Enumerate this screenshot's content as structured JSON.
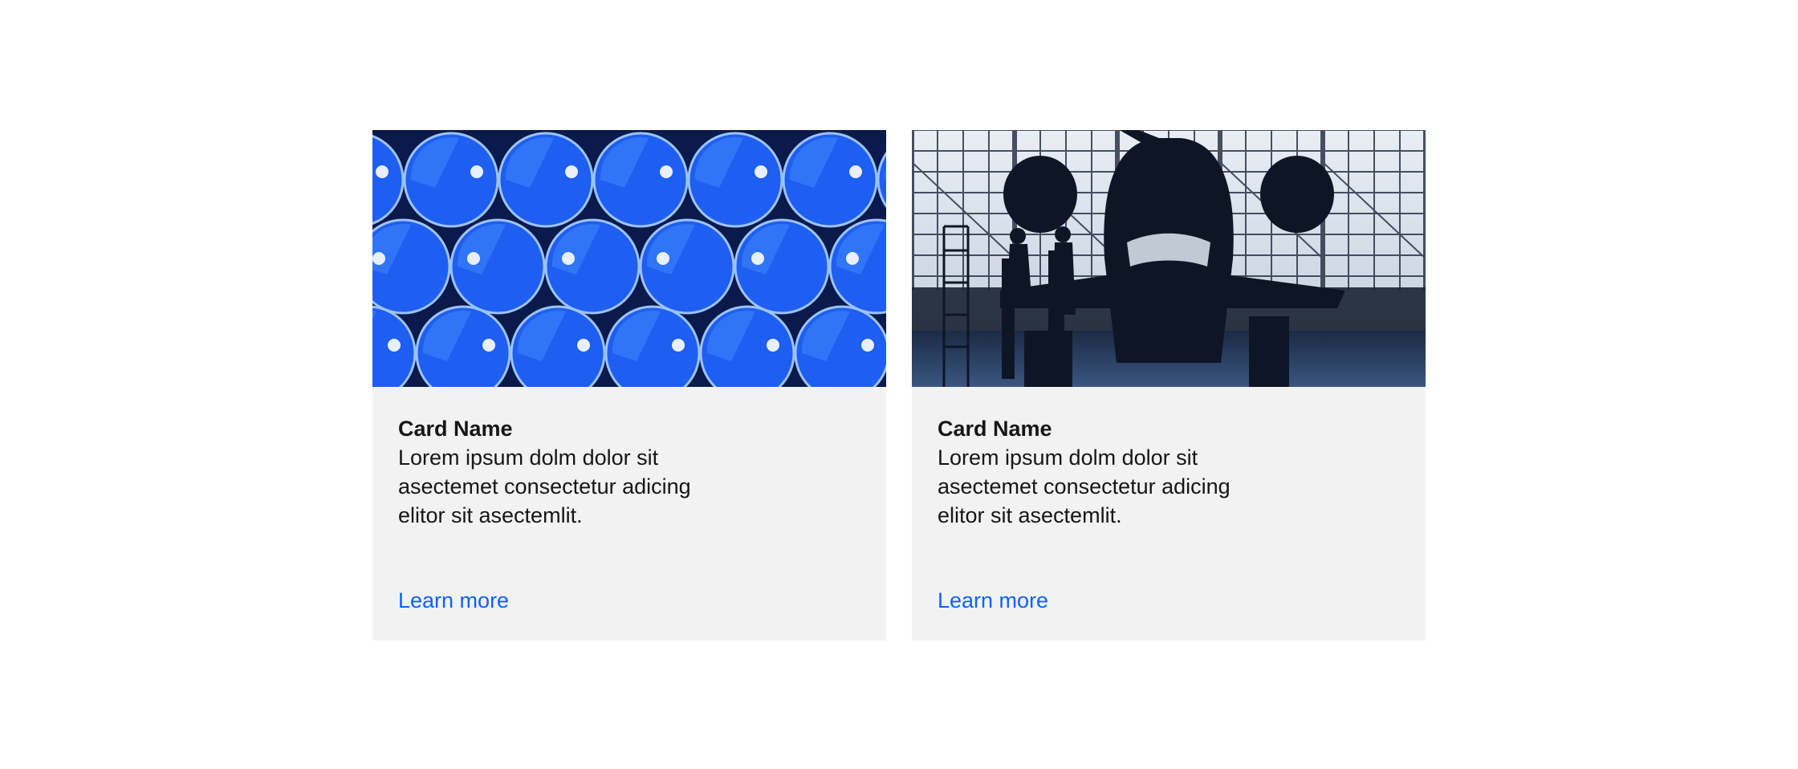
{
  "cards": [
    {
      "image_label": "blue-barrels-image",
      "title": "Card Name",
      "description": "Lorem ipsum dolm dolor sit asectemet consectetur adicing elitor sit asectemlit.",
      "link_label": "Learn more"
    },
    {
      "image_label": "aircraft-hangar-image",
      "title": "Card Name",
      "description": "Lorem ipsum dolm dolor sit asectemet consectetur adicing elitor sit asectemlit.",
      "link_label": "Learn more"
    }
  ],
  "colors": {
    "card_background": "#f2f2f2",
    "link": "#0f62fe",
    "text": "#161616"
  }
}
